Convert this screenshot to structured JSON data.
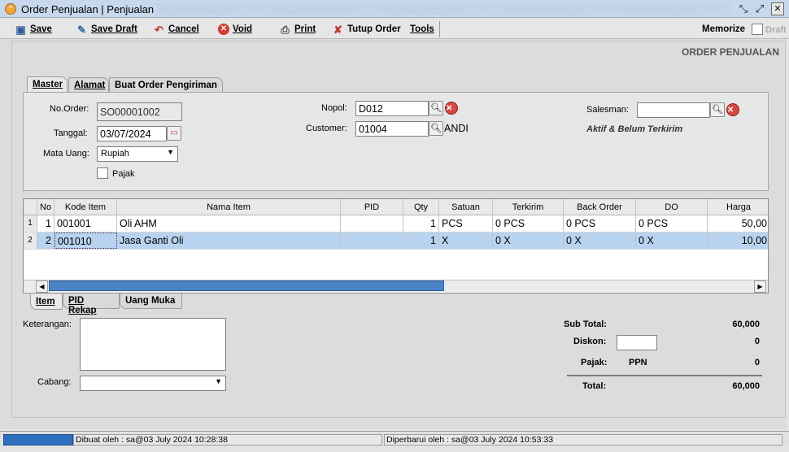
{
  "window": {
    "title": "Order Penjualan | Penjualan"
  },
  "toolbar": {
    "save": "Save",
    "save_draft": "Save Draft",
    "cancel": "Cancel",
    "void": "Void",
    "print": "Print",
    "tutup_order": "Tutup Order",
    "tools": "Tools",
    "memorize": "Memorize",
    "draft": "Draft"
  },
  "page_title": "ORDER PENJUALAN",
  "top_tabs": [
    "Master",
    "Alamat",
    "Buat Order Pengiriman"
  ],
  "master": {
    "no_order_label": "No.Order:",
    "no_order": "SO00001002",
    "tanggal_label": "Tanggal:",
    "tanggal": "03/07/2024",
    "mata_uang_label": "Mata Uang:",
    "mata_uang": "Rupiah",
    "pajak_label": "Pajak",
    "nopol_label": "Nopol:",
    "nopol": "D012",
    "customer_label": "Customer:",
    "customer_code": "01004",
    "customer_name": "ANDI",
    "salesman_label": "Salesman:",
    "salesman": "",
    "status": "Aktif & Belum Terkirim"
  },
  "grid": {
    "columns": [
      "No",
      "Kode Item",
      "Nama Item",
      "PID",
      "Qty",
      "Satuan",
      "Terkirim",
      "Back Order",
      "DO",
      "Harga"
    ],
    "rows": [
      {
        "rownum": "1",
        "no": "1",
        "kode": "001001",
        "nama": "Oli AHM",
        "pid": "",
        "qty": "1",
        "satuan": "PCS",
        "terkirim": "0 PCS",
        "back_order": "0 PCS",
        "do": "0 PCS",
        "harga": "50,00"
      },
      {
        "rownum": "2",
        "no": "2",
        "kode": "001010",
        "nama": "Jasa Ganti Oli",
        "pid": "",
        "qty": "1",
        "satuan": "X",
        "terkirim": "0 X",
        "back_order": "0 X",
        "do": "0 X",
        "harga": "10,00"
      }
    ]
  },
  "bottom_tabs": [
    "Item",
    "PID Rekap",
    "Uang Muka"
  ],
  "bottom": {
    "keterangan_label": "Keterangan:",
    "cabang_label": "Cabang:",
    "sub_total_label": "Sub Total:",
    "sub_total": "60,000",
    "diskon_label": "Diskon:",
    "diskon": "0",
    "pajak_label": "Pajak:",
    "pajak_type": "PPN",
    "pajak": "0",
    "total_label": "Total:",
    "total": "60,000"
  },
  "status": {
    "dibuat": "Dibuat oleh : sa@03 July 2024  10:28:38",
    "diperbarui": "Diperbarui oleh : sa@03 July 2024  10:53:33"
  },
  "colors": {
    "selected_row": "#b8d3ef",
    "scroll_thumb": "#4a84c6",
    "titlebar": "#c8d8ec"
  }
}
